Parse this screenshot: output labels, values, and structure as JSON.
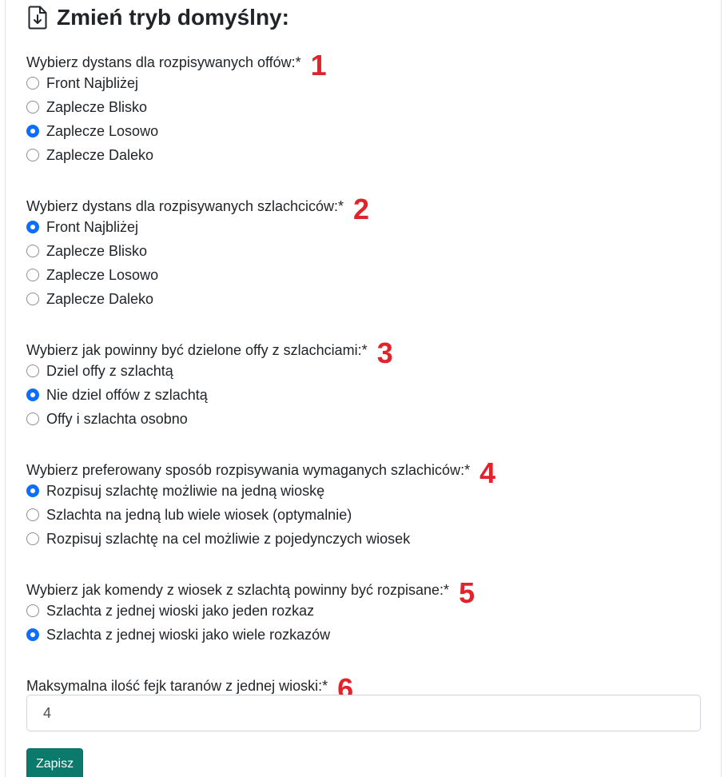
{
  "form": {
    "title": "Zmień tryb domyślny:",
    "title_icon": "file-download-icon",
    "questions": [
      {
        "label": "Wybierz dystans dla rozpisywanych offów:*",
        "marker": "1",
        "options": [
          "Front Najbliżej",
          "Zaplecze Blisko",
          "Zaplecze Losowo",
          "Zaplecze Daleko"
        ],
        "selected": "Zaplecze Losowo"
      },
      {
        "label": "Wybierz dystans dla rozpisywanych szlachciców:*",
        "marker": "2",
        "options": [
          "Front Najbliżej",
          "Zaplecze Blisko",
          "Zaplecze Losowo",
          "Zaplecze Daleko"
        ],
        "selected": "Front Najbliżej"
      },
      {
        "label": "Wybierz jak powinny być dzielone offy z szlachciami:*",
        "marker": "3",
        "options": [
          "Dziel offy z szlachtą",
          "Nie dziel offów z szlachtą",
          "Offy i szlachta osobno"
        ],
        "selected": "Nie dziel offów z szlachtą"
      },
      {
        "label": "Wybierz preferowany sposób rozpisywania wymaganych szlachiców:*",
        "marker": "4",
        "options": [
          "Rozpisuj szlachtę możliwie na jedną wioskę",
          "Szlachta na jedną lub wiele wiosek (optymalnie)",
          "Rozpisuj szlachtę na cel możliwie z pojedynczych wiosek"
        ],
        "selected": "Rozpisuj szlachtę możliwie na jedną wioskę"
      },
      {
        "label": "Wybierz jak komendy z wiosek z szlachtą powinny być rozpisane:*",
        "marker": "5",
        "options": [
          "Szlachta z jednej wioski jako jeden rozkaz",
          "Szlachta z jednej wioski jako wiele rozkazów"
        ],
        "selected": "Szlachta z jednej wioski jako wiele rozkazów"
      }
    ],
    "max_fake": {
      "label": "Maksymalna ilość fejk taranów z jednej wioski:*",
      "marker": "6",
      "value": "4"
    },
    "submit_label": "Zapisz"
  },
  "colors": {
    "marker": "#e2242a",
    "radio_checked": "#0d6efd",
    "button": "#0b7a6d"
  }
}
